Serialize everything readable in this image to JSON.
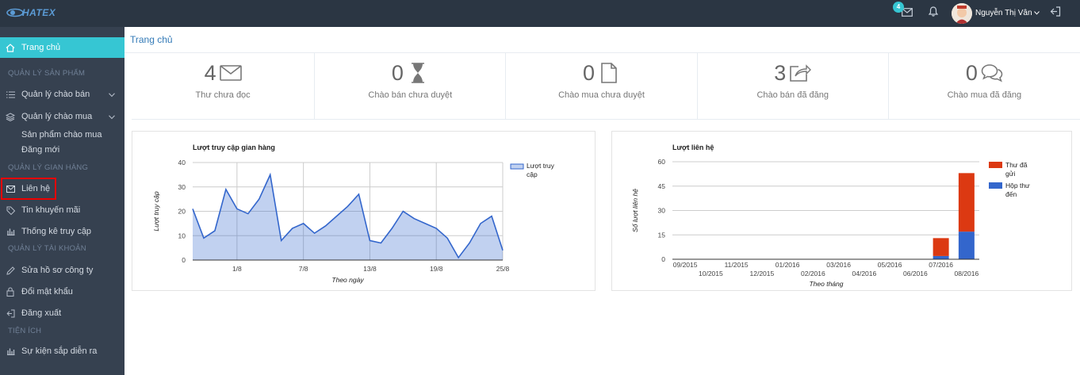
{
  "header": {
    "logo_text": "HATEX",
    "mail_badge": "4",
    "user_name": "Nguyễn Thị Vân",
    "icons": [
      "mail-icon",
      "bell-icon",
      "avatar",
      "chevron-down-icon",
      "logout-icon"
    ]
  },
  "sidebar": {
    "home": "Trang chủ",
    "section_products": "QUẢN LÝ SẢN PHẨM",
    "offers_sell": "Quản lý chào bán",
    "offers_buy": "Quản lý chào mua",
    "buy_products": "Sản phẩm chào mua",
    "post_new": "Đăng mới",
    "section_store": "QUẢN LÝ GIAN HÀNG",
    "contact": "Liên hệ",
    "promotions": "Tin khuyến mãi",
    "stats": "Thống kê truy cập",
    "section_account": "QUẢN LÝ TÀI KHOẢN",
    "edit_profile": "Sửa hồ sơ công ty",
    "change_password": "Đổi mật khẩu",
    "logout": "Đăng xuất",
    "section_utils": "TIỆN ÍCH",
    "events": "Sự kiện sắp diễn ra",
    "accent_color": "#36c6d3"
  },
  "breadcrumb": "Trang chủ",
  "stats": [
    {
      "value": "4",
      "label": "Thư chưa đọc",
      "icon": "envelope-icon"
    },
    {
      "value": "0",
      "label": "Chào bán chưa duyệt",
      "icon": "hourglass-icon"
    },
    {
      "value": "0",
      "label": "Chào mua chưa duyệt",
      "icon": "file-icon"
    },
    {
      "value": "3",
      "label": "Chào bán đã đăng",
      "icon": "share-icon"
    },
    {
      "value": "0",
      "label": "Chào mua đã đăng",
      "icon": "comments-icon"
    }
  ],
  "chart_data": [
    {
      "type": "area",
      "title": "Lượt truy cập gian hàng",
      "xlabel": "Theo ngày",
      "ylabel": "Lượt truy cập",
      "ylim": [
        0,
        40
      ],
      "yticks": [
        0,
        10,
        20,
        30,
        40
      ],
      "x_tick_labels": [
        {
          "label": "1/8",
          "index": 4
        },
        {
          "label": "7/8",
          "index": 10
        },
        {
          "label": "13/8",
          "index": 16
        },
        {
          "label": "19/8",
          "index": 22
        },
        {
          "label": "25/8",
          "index": 28
        }
      ],
      "legend_position": "right",
      "color": "#3366cc",
      "series": [
        {
          "name": "Lượt truy cập",
          "values": [
            21,
            9,
            12,
            29,
            21,
            19,
            25,
            35,
            8,
            13,
            15,
            11,
            14,
            18,
            22,
            27,
            8,
            7,
            13,
            20,
            17,
            15,
            13,
            9,
            1,
            7,
            15,
            18,
            4
          ]
        }
      ]
    },
    {
      "type": "bar",
      "stacked": true,
      "title": "Lượt liên hệ",
      "xlabel": "Theo tháng",
      "ylabel": "Số lượt liên hệ",
      "ylim": [
        0,
        60
      ],
      "yticks": [
        0,
        15,
        30,
        45,
        60
      ],
      "categories": [
        "09/2015",
        "10/2015",
        "11/2015",
        "12/2015",
        "01/2016",
        "02/2016",
        "03/2016",
        "04/2016",
        "05/2016",
        "06/2016",
        "07/2016",
        "08/2016"
      ],
      "legend_position": "right",
      "series": [
        {
          "name": "Hộp thư đến",
          "color": "#3366cc",
          "values": [
            0,
            0,
            0,
            0,
            0,
            0,
            0,
            0,
            0,
            0,
            2,
            17
          ]
        },
        {
          "name": "Thư đã gửi",
          "color": "#dc3912",
          "values": [
            0,
            0,
            0,
            0,
            0,
            0,
            0,
            0,
            0,
            0,
            11,
            36
          ]
        }
      ]
    }
  ]
}
